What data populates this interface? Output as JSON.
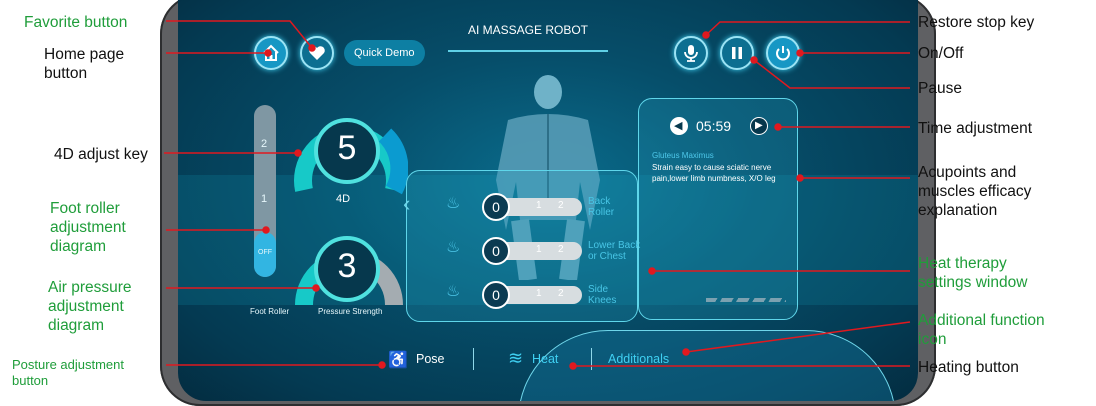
{
  "device": {
    "title": "AI MASSAGE ROBOT",
    "quick_demo": "Quick Demo",
    "left_slider": {
      "tick_2": "2",
      "tick_1": "1",
      "off": "OFF"
    },
    "dial_4d": {
      "value": "5",
      "label": "4D"
    },
    "dial_pressure": {
      "value": "3"
    },
    "foot_roller_label": "Foot Roller",
    "pressure_strength_label": "Pressure Strength",
    "heat_rows": [
      {
        "value": "0",
        "ticks": [
          "1",
          "2"
        ],
        "text": "Back\nRoller"
      },
      {
        "value": "0",
        "ticks": [
          "1",
          "2"
        ],
        "text": "Lower Back\nor Chest"
      },
      {
        "value": "0",
        "ticks": [
          "1",
          "2"
        ],
        "text": "Side\nKnees"
      }
    ],
    "time": "05:59",
    "acu_title": "Gluteus Maximus",
    "acu_text": "Strain easy to cause sciatic nerve pain,lower limb numbness, X/O leg",
    "bottom": {
      "pose": "Pose",
      "heat": "Heat",
      "additionals": "Additionals"
    }
  },
  "callouts": {
    "favorite": "Favorite button",
    "home": "Home page\nbutton",
    "adj4d": "4D adjust key",
    "foot": "Foot roller\nadjustment\ndiagram",
    "air": "Air pressure\nadjustment\ndiagram",
    "posture": "Posture adjustment\nbutton",
    "restore": "Restore stop key",
    "onoff": "On/Off",
    "pause": "Pause",
    "time": "Time adjustment",
    "acupoints": "Acupoints and\nmuscles efficacy\nexplanation",
    "heat_window": "Heat therapy\nsettings window",
    "additional": "Additional function\nicon",
    "heating": "Heating button"
  },
  "colors": {
    "callout_line": "#e0191f",
    "green_label": "#1f9d3a",
    "accent": "#1697c4"
  }
}
